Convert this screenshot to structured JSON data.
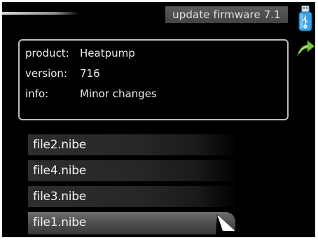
{
  "header": {
    "title": "update firmware 7.1"
  },
  "icons": {
    "usb": "usb-stick-icon",
    "back": "back-arrow-icon"
  },
  "info": {
    "rows": [
      {
        "key": "product:",
        "value": "Heatpump"
      },
      {
        "key": "version:",
        "value": "716"
      },
      {
        "key": "info:",
        "value": "Minor changes"
      }
    ]
  },
  "files": [
    {
      "name": "file2.nibe",
      "selected": false
    },
    {
      "name": "file4.nibe",
      "selected": false
    },
    {
      "name": "file3.nibe",
      "selected": false
    },
    {
      "name": "file1.nibe",
      "selected": true
    }
  ],
  "colors": {
    "background": "#000000",
    "usb_icon": "#3aa0e0",
    "arrow_icon": "#8bd24a"
  }
}
